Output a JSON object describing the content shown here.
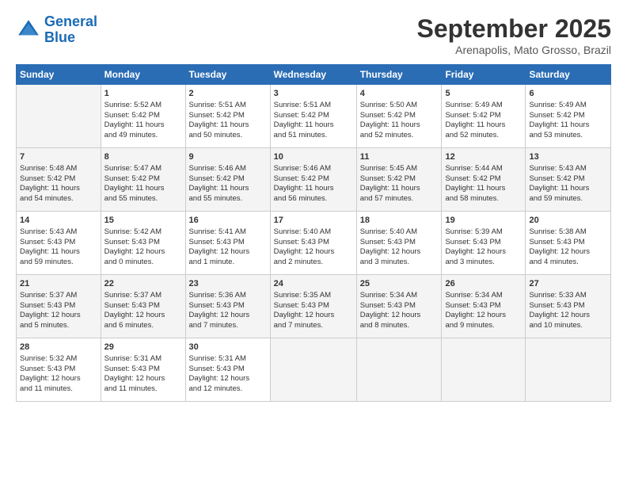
{
  "logo": {
    "line1": "General",
    "line2": "Blue"
  },
  "title": "September 2025",
  "subtitle": "Arenapolis, Mato Grosso, Brazil",
  "days_of_week": [
    "Sunday",
    "Monday",
    "Tuesday",
    "Wednesday",
    "Thursday",
    "Friday",
    "Saturday"
  ],
  "weeks": [
    [
      {
        "day": "",
        "info": ""
      },
      {
        "day": "1",
        "info": "Sunrise: 5:52 AM\nSunset: 5:42 PM\nDaylight: 11 hours\nand 49 minutes."
      },
      {
        "day": "2",
        "info": "Sunrise: 5:51 AM\nSunset: 5:42 PM\nDaylight: 11 hours\nand 50 minutes."
      },
      {
        "day": "3",
        "info": "Sunrise: 5:51 AM\nSunset: 5:42 PM\nDaylight: 11 hours\nand 51 minutes."
      },
      {
        "day": "4",
        "info": "Sunrise: 5:50 AM\nSunset: 5:42 PM\nDaylight: 11 hours\nand 52 minutes."
      },
      {
        "day": "5",
        "info": "Sunrise: 5:49 AM\nSunset: 5:42 PM\nDaylight: 11 hours\nand 52 minutes."
      },
      {
        "day": "6",
        "info": "Sunrise: 5:49 AM\nSunset: 5:42 PM\nDaylight: 11 hours\nand 53 minutes."
      }
    ],
    [
      {
        "day": "7",
        "info": "Sunrise: 5:48 AM\nSunset: 5:42 PM\nDaylight: 11 hours\nand 54 minutes."
      },
      {
        "day": "8",
        "info": "Sunrise: 5:47 AM\nSunset: 5:42 PM\nDaylight: 11 hours\nand 55 minutes."
      },
      {
        "day": "9",
        "info": "Sunrise: 5:46 AM\nSunset: 5:42 PM\nDaylight: 11 hours\nand 55 minutes."
      },
      {
        "day": "10",
        "info": "Sunrise: 5:46 AM\nSunset: 5:42 PM\nDaylight: 11 hours\nand 56 minutes."
      },
      {
        "day": "11",
        "info": "Sunrise: 5:45 AM\nSunset: 5:42 PM\nDaylight: 11 hours\nand 57 minutes."
      },
      {
        "day": "12",
        "info": "Sunrise: 5:44 AM\nSunset: 5:42 PM\nDaylight: 11 hours\nand 58 minutes."
      },
      {
        "day": "13",
        "info": "Sunrise: 5:43 AM\nSunset: 5:42 PM\nDaylight: 11 hours\nand 59 minutes."
      }
    ],
    [
      {
        "day": "14",
        "info": "Sunrise: 5:43 AM\nSunset: 5:43 PM\nDaylight: 11 hours\nand 59 minutes."
      },
      {
        "day": "15",
        "info": "Sunrise: 5:42 AM\nSunset: 5:43 PM\nDaylight: 12 hours\nand 0 minutes."
      },
      {
        "day": "16",
        "info": "Sunrise: 5:41 AM\nSunset: 5:43 PM\nDaylight: 12 hours\nand 1 minute."
      },
      {
        "day": "17",
        "info": "Sunrise: 5:40 AM\nSunset: 5:43 PM\nDaylight: 12 hours\nand 2 minutes."
      },
      {
        "day": "18",
        "info": "Sunrise: 5:40 AM\nSunset: 5:43 PM\nDaylight: 12 hours\nand 3 minutes."
      },
      {
        "day": "19",
        "info": "Sunrise: 5:39 AM\nSunset: 5:43 PM\nDaylight: 12 hours\nand 3 minutes."
      },
      {
        "day": "20",
        "info": "Sunrise: 5:38 AM\nSunset: 5:43 PM\nDaylight: 12 hours\nand 4 minutes."
      }
    ],
    [
      {
        "day": "21",
        "info": "Sunrise: 5:37 AM\nSunset: 5:43 PM\nDaylight: 12 hours\nand 5 minutes."
      },
      {
        "day": "22",
        "info": "Sunrise: 5:37 AM\nSunset: 5:43 PM\nDaylight: 12 hours\nand 6 minutes."
      },
      {
        "day": "23",
        "info": "Sunrise: 5:36 AM\nSunset: 5:43 PM\nDaylight: 12 hours\nand 7 minutes."
      },
      {
        "day": "24",
        "info": "Sunrise: 5:35 AM\nSunset: 5:43 PM\nDaylight: 12 hours\nand 7 minutes."
      },
      {
        "day": "25",
        "info": "Sunrise: 5:34 AM\nSunset: 5:43 PM\nDaylight: 12 hours\nand 8 minutes."
      },
      {
        "day": "26",
        "info": "Sunrise: 5:34 AM\nSunset: 5:43 PM\nDaylight: 12 hours\nand 9 minutes."
      },
      {
        "day": "27",
        "info": "Sunrise: 5:33 AM\nSunset: 5:43 PM\nDaylight: 12 hours\nand 10 minutes."
      }
    ],
    [
      {
        "day": "28",
        "info": "Sunrise: 5:32 AM\nSunset: 5:43 PM\nDaylight: 12 hours\nand 11 minutes."
      },
      {
        "day": "29",
        "info": "Sunrise: 5:31 AM\nSunset: 5:43 PM\nDaylight: 12 hours\nand 11 minutes."
      },
      {
        "day": "30",
        "info": "Sunrise: 5:31 AM\nSunset: 5:43 PM\nDaylight: 12 hours\nand 12 minutes."
      },
      {
        "day": "",
        "info": ""
      },
      {
        "day": "",
        "info": ""
      },
      {
        "day": "",
        "info": ""
      },
      {
        "day": "",
        "info": ""
      }
    ]
  ]
}
